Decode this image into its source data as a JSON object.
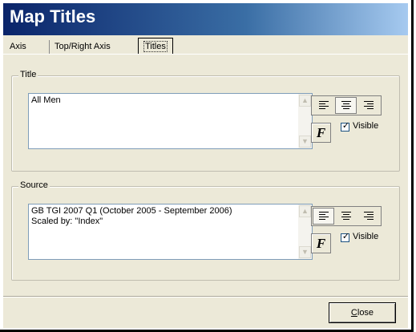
{
  "window": {
    "title": "Map Titles"
  },
  "tabs": [
    {
      "label": "Axis"
    },
    {
      "label": "Top/Right Axis"
    },
    {
      "label": "Titles",
      "active": true
    }
  ],
  "title_group": {
    "label": "Title",
    "text_lines": [
      "All Men"
    ],
    "alignment": "center",
    "font_button": "F",
    "visible_label": "Visible",
    "visible_checked": true
  },
  "source_group": {
    "label": "Source",
    "text_lines": [
      "GB TGI 2007 Q1 (October 2005 - September 2006)",
      "Scaled by: \"Index\""
    ],
    "alignment": "left",
    "font_button": "F",
    "visible_label": "Visible",
    "visible_checked": true
  },
  "footer": {
    "close_label_prefix": "C",
    "close_label_rest": "lose"
  },
  "colors": {
    "titlebar_start": "#0a246a",
    "titlebar_end": "#a6caf0",
    "dialog_bg": "#ece9d8"
  }
}
